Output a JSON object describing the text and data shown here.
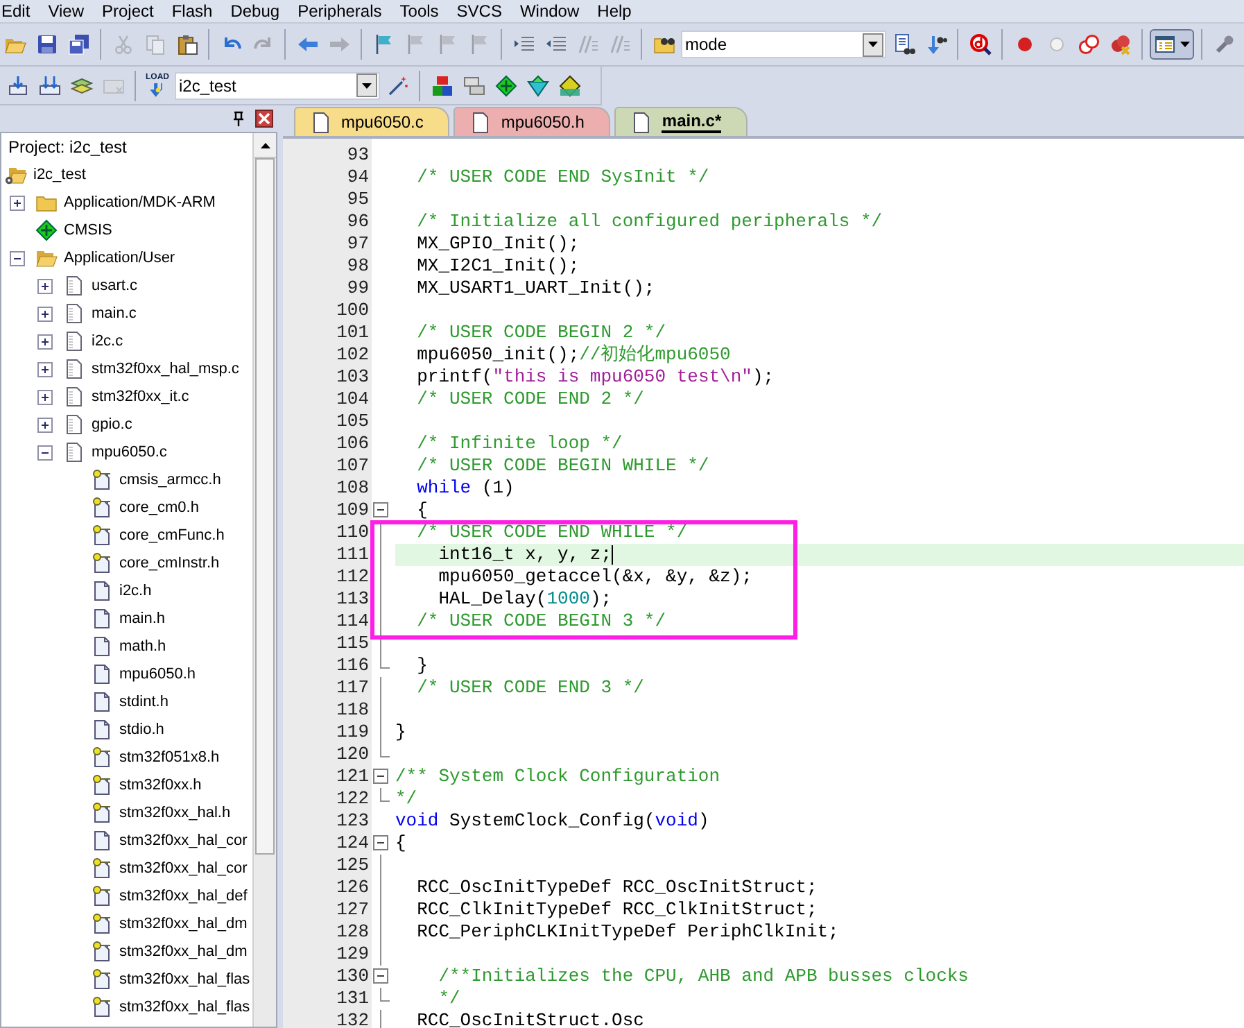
{
  "menu": [
    "Edit",
    "View",
    "Project",
    "Flash",
    "Debug",
    "Peripherals",
    "Tools",
    "SVCS",
    "Window",
    "Help"
  ],
  "toolbar_top": [
    {
      "kind": "open",
      "disabled": false
    },
    {
      "kind": "save",
      "disabled": false
    },
    {
      "kind": "save-all",
      "disabled": false
    },
    {
      "kind": "separator"
    },
    {
      "kind": "cut",
      "disabled": true
    },
    {
      "kind": "copy",
      "disabled": true
    },
    {
      "kind": "paste",
      "disabled": false
    },
    {
      "kind": "separator"
    },
    {
      "kind": "undo",
      "disabled": false
    },
    {
      "kind": "redo",
      "disabled": true
    },
    {
      "kind": "separator"
    },
    {
      "kind": "back",
      "disabled": false
    },
    {
      "kind": "forward",
      "disabled": true
    },
    {
      "kind": "separator"
    },
    {
      "kind": "bookmark",
      "disabled": false
    },
    {
      "kind": "bookmark",
      "disabled": true
    },
    {
      "kind": "bookmark",
      "disabled": true
    },
    {
      "kind": "bookmark",
      "disabled": true
    },
    {
      "kind": "separator"
    },
    {
      "kind": "indent",
      "disabled": false
    },
    {
      "kind": "unindent",
      "disabled": false
    },
    {
      "kind": "comment",
      "disabled": true
    },
    {
      "kind": "comment",
      "disabled": true
    },
    {
      "kind": "separator"
    },
    {
      "kind": "find-files",
      "disabled": false
    },
    {
      "kind": "combo",
      "value": "mode"
    },
    {
      "kind": "find",
      "disabled": false
    },
    {
      "kind": "find-next",
      "disabled": false
    },
    {
      "kind": "separator"
    },
    {
      "kind": "debug",
      "disabled": false
    },
    {
      "kind": "separator"
    },
    {
      "kind": "breakpoint",
      "disabled": false
    },
    {
      "kind": "breakpoint-off",
      "disabled": false
    },
    {
      "kind": "breakpoint-disable",
      "disabled": false
    },
    {
      "kind": "breakpoint-kill",
      "disabled": false
    },
    {
      "kind": "separator"
    },
    {
      "kind": "window",
      "disabled": false
    },
    {
      "kind": "separator"
    },
    {
      "kind": "wrench",
      "disabled": false
    }
  ],
  "toolbar_build": [
    {
      "kind": "translate",
      "disabled": false
    },
    {
      "kind": "build",
      "disabled": false
    },
    {
      "kind": "rebuild",
      "disabled": false
    },
    {
      "kind": "batch",
      "disabled": true
    },
    {
      "kind": "separator"
    },
    {
      "kind": "load",
      "label": "LOAD"
    },
    {
      "kind": "combo",
      "value": "i2c_test"
    },
    {
      "kind": "wand",
      "disabled": false
    },
    {
      "kind": "separator"
    },
    {
      "kind": "rte",
      "disabled": false
    },
    {
      "kind": "manage",
      "disabled": false
    },
    {
      "kind": "diamond",
      "disabled": false
    },
    {
      "kind": "funnel",
      "disabled": false
    },
    {
      "kind": "pack",
      "disabled": false
    }
  ],
  "project_panel": {
    "title": "Project: i2c_test",
    "tree": [
      {
        "label": "i2c_test",
        "kind": "project",
        "children": [
          {
            "label": "Application/MDK-ARM",
            "kind": "folder",
            "expanded": false
          },
          {
            "label": "CMSIS",
            "kind": "component"
          },
          {
            "label": "Application/User",
            "kind": "folder",
            "expanded": true,
            "children": [
              {
                "label": "usart.c",
                "kind": "source",
                "expanded": false
              },
              {
                "label": "main.c",
                "kind": "source",
                "expanded": false
              },
              {
                "label": "i2c.c",
                "kind": "source",
                "expanded": false
              },
              {
                "label": "stm32f0xx_hal_msp.c",
                "kind": "source",
                "expanded": false
              },
              {
                "label": "stm32f0xx_it.c",
                "kind": "source",
                "expanded": false
              },
              {
                "label": "gpio.c",
                "kind": "source",
                "expanded": false
              },
              {
                "label": "mpu6050.c",
                "kind": "source",
                "expanded": true,
                "children": [
                  {
                    "label": "cmsis_armcc.h",
                    "kind": "header-key"
                  },
                  {
                    "label": "core_cm0.h",
                    "kind": "header-key"
                  },
                  {
                    "label": "core_cmFunc.h",
                    "kind": "header-key"
                  },
                  {
                    "label": "core_cmInstr.h",
                    "kind": "header-key"
                  },
                  {
                    "label": "i2c.h",
                    "kind": "header"
                  },
                  {
                    "label": "main.h",
                    "kind": "header"
                  },
                  {
                    "label": "math.h",
                    "kind": "header"
                  },
                  {
                    "label": "mpu6050.h",
                    "kind": "header"
                  },
                  {
                    "label": "stdint.h",
                    "kind": "header"
                  },
                  {
                    "label": "stdio.h",
                    "kind": "header"
                  },
                  {
                    "label": "stm32f051x8.h",
                    "kind": "header-key"
                  },
                  {
                    "label": "stm32f0xx.h",
                    "kind": "header-key"
                  },
                  {
                    "label": "stm32f0xx_hal.h",
                    "kind": "header-key"
                  },
                  {
                    "label": "stm32f0xx_hal_cor",
                    "kind": "header"
                  },
                  {
                    "label": "stm32f0xx_hal_cor",
                    "kind": "header-key"
                  },
                  {
                    "label": "stm32f0xx_hal_def",
                    "kind": "header-key"
                  },
                  {
                    "label": "stm32f0xx_hal_dm",
                    "kind": "header-key"
                  },
                  {
                    "label": "stm32f0xx_hal_dm",
                    "kind": "header-key"
                  },
                  {
                    "label": "stm32f0xx_hal_flas",
                    "kind": "header-key"
                  },
                  {
                    "label": "stm32f0xx_hal_flas",
                    "kind": "header-key"
                  }
                ]
              }
            ]
          }
        ]
      }
    ]
  },
  "editor": {
    "tabs": [
      {
        "label": "mpu6050.c",
        "selected": false,
        "color": "#f7dc8a"
      },
      {
        "label": "mpu6050.h",
        "selected": false,
        "color": "#ecaeae"
      },
      {
        "label": "main.c*",
        "selected": true,
        "color": "#cdd8b4"
      }
    ],
    "lines": [
      {
        "number": "93",
        "kind": "plain",
        "current": false,
        "boxed": false
      },
      {
        "number": "94",
        "kind": "plain",
        "current": false,
        "boxed": false,
        "segs": [
          {
            "kind": "comment",
            "text": "  /* USER CODE END SysInit */"
          }
        ]
      },
      {
        "number": "95",
        "kind": "plain",
        "current": false,
        "boxed": false
      },
      {
        "number": "96",
        "kind": "plain",
        "current": false,
        "boxed": false,
        "segs": [
          {
            "kind": "comment",
            "text": "  /* Initialize all configured peripherals */"
          }
        ]
      },
      {
        "number": "97",
        "kind": "plain",
        "current": false,
        "boxed": false,
        "segs": [
          {
            "kind": "plain",
            "text": "  MX_GPIO_Init();"
          }
        ]
      },
      {
        "number": "98",
        "kind": "plain",
        "current": false,
        "boxed": false,
        "segs": [
          {
            "kind": "plain",
            "text": "  MX_I2C1_Init();"
          }
        ]
      },
      {
        "number": "99",
        "kind": "plain",
        "current": false,
        "boxed": false,
        "segs": [
          {
            "kind": "plain",
            "text": "  MX_USART1_UART_Init();"
          }
        ]
      },
      {
        "number": "100",
        "kind": "plain",
        "current": false,
        "boxed": false
      },
      {
        "number": "101",
        "kind": "plain",
        "current": false,
        "boxed": false,
        "segs": [
          {
            "kind": "comment",
            "text": "  /* USER CODE BEGIN 2 */"
          }
        ]
      },
      {
        "number": "102",
        "kind": "plain",
        "current": false,
        "boxed": false,
        "segs": [
          {
            "kind": "plain",
            "text": "  mpu6050_init();"
          },
          {
            "kind": "comment",
            "text": "//初始化mpu6050"
          }
        ]
      },
      {
        "number": "103",
        "kind": "plain",
        "current": false,
        "boxed": false,
        "segs": [
          {
            "kind": "plain",
            "text": "  printf("
          },
          {
            "kind": "string",
            "text": "\"this is mpu6050 test\\n\""
          },
          {
            "kind": "plain",
            "text": ");"
          }
        ]
      },
      {
        "number": "104",
        "kind": "plain",
        "current": false,
        "boxed": false,
        "segs": [
          {
            "kind": "comment",
            "text": "  /* USER CODE END 2 */"
          }
        ]
      },
      {
        "number": "105",
        "kind": "plain",
        "current": false,
        "boxed": false
      },
      {
        "number": "106",
        "kind": "plain",
        "current": false,
        "boxed": false,
        "segs": [
          {
            "kind": "comment",
            "text": "  /* Infinite loop */"
          }
        ]
      },
      {
        "number": "107",
        "kind": "plain",
        "current": false,
        "boxed": false,
        "segs": [
          {
            "kind": "comment",
            "text": "  /* USER CODE BEGIN WHILE */"
          }
        ]
      },
      {
        "number": "108",
        "kind": "plain",
        "current": false,
        "boxed": false,
        "segs": [
          {
            "kind": "keyword",
            "text": "  while"
          },
          {
            "kind": "plain",
            "text": " (1)"
          }
        ]
      },
      {
        "number": "109",
        "kind": "fold-start",
        "current": false,
        "boxed": false,
        "segs": [
          {
            "kind": "plain",
            "text": "  {"
          }
        ]
      },
      {
        "number": "110",
        "kind": "fold-inner",
        "current": false,
        "boxed": true,
        "segs": [
          {
            "kind": "comment",
            "text": "  /* USER CODE END WHILE */"
          }
        ]
      },
      {
        "number": "111",
        "kind": "fold-inner",
        "current": true,
        "boxed": true,
        "segs": [
          {
            "kind": "plain",
            "text": "    int16_t x, y, z;"
          }
        ]
      },
      {
        "number": "112",
        "kind": "fold-inner",
        "current": false,
        "boxed": true,
        "segs": [
          {
            "kind": "plain",
            "text": "    mpu6050_getaccel(&x, &y, &z);"
          }
        ]
      },
      {
        "number": "113",
        "kind": "fold-inner",
        "current": false,
        "boxed": true,
        "segs": [
          {
            "kind": "plain",
            "text": "    HAL_Delay("
          },
          {
            "kind": "number",
            "text": "1000"
          },
          {
            "kind": "plain",
            "text": ");"
          }
        ]
      },
      {
        "number": "114",
        "kind": "fold-inner",
        "current": false,
        "boxed": true,
        "segs": [
          {
            "kind": "comment",
            "text": "  /* USER CODE BEGIN 3 */"
          }
        ]
      },
      {
        "number": "115",
        "kind": "fold-inner",
        "current": false,
        "boxed": false
      },
      {
        "number": "116",
        "kind": "fold-end",
        "current": false,
        "boxed": false,
        "segs": [
          {
            "kind": "plain",
            "text": "  }"
          }
        ]
      },
      {
        "number": "117",
        "kind": "fold-inner",
        "current": false,
        "boxed": false,
        "segs": [
          {
            "kind": "comment",
            "text": "  /* USER CODE END 3 */"
          }
        ]
      },
      {
        "number": "118",
        "kind": "fold-inner",
        "current": false,
        "boxed": false
      },
      {
        "number": "119",
        "kind": "fold-inner",
        "current": false,
        "boxed": false,
        "segs": [
          {
            "kind": "plain",
            "text": "}"
          }
        ]
      },
      {
        "number": "120",
        "kind": "fold-end",
        "current": false,
        "boxed": false
      },
      {
        "number": "121",
        "kind": "fold-start",
        "current": false,
        "boxed": false,
        "segs": [
          {
            "kind": "comment",
            "text": "/** System Clock Configuration"
          }
        ]
      },
      {
        "number": "122",
        "kind": "fold-end",
        "current": false,
        "boxed": false,
        "segs": [
          {
            "kind": "comment",
            "text": "*/"
          }
        ]
      },
      {
        "number": "123",
        "kind": "plain",
        "current": false,
        "boxed": false,
        "segs": [
          {
            "kind": "keyword",
            "text": "void"
          },
          {
            "kind": "plain",
            "text": " SystemClock_Config("
          },
          {
            "kind": "keyword",
            "text": "void"
          },
          {
            "kind": "plain",
            "text": ")"
          }
        ]
      },
      {
        "number": "124",
        "kind": "fold-start",
        "current": false,
        "boxed": false,
        "segs": [
          {
            "kind": "plain",
            "text": "{"
          }
        ]
      },
      {
        "number": "125",
        "kind": "fold-inner",
        "current": false,
        "boxed": false
      },
      {
        "number": "126",
        "kind": "fold-inner",
        "current": false,
        "boxed": false,
        "segs": [
          {
            "kind": "plain",
            "text": "  RCC_OscInitTypeDef RCC_OscInitStruct;"
          }
        ]
      },
      {
        "number": "127",
        "kind": "fold-inner",
        "current": false,
        "boxed": false,
        "segs": [
          {
            "kind": "plain",
            "text": "  RCC_ClkInitTypeDef RCC_ClkInitStruct;"
          }
        ]
      },
      {
        "number": "128",
        "kind": "fold-inner",
        "current": false,
        "boxed": false,
        "segs": [
          {
            "kind": "plain",
            "text": "  RCC_PeriphCLKInitTypeDef PeriphClkInit;"
          }
        ]
      },
      {
        "number": "129",
        "kind": "fold-inner",
        "current": false,
        "boxed": false
      },
      {
        "number": "130",
        "kind": "fold-start",
        "current": false,
        "boxed": false,
        "segs": [
          {
            "kind": "comment",
            "text": "    /**Initializes the CPU, AHB and APB busses clocks"
          }
        ]
      },
      {
        "number": "131",
        "kind": "fold-end",
        "current": false,
        "boxed": false,
        "segs": [
          {
            "kind": "comment",
            "text": "    */"
          }
        ]
      },
      {
        "number": "132",
        "kind": "fold-inner",
        "current": false,
        "boxed": false,
        "segs": [
          {
            "kind": "plain",
            "text": "  RCC_OscInitStruct.Osc"
          }
        ]
      }
    ]
  }
}
